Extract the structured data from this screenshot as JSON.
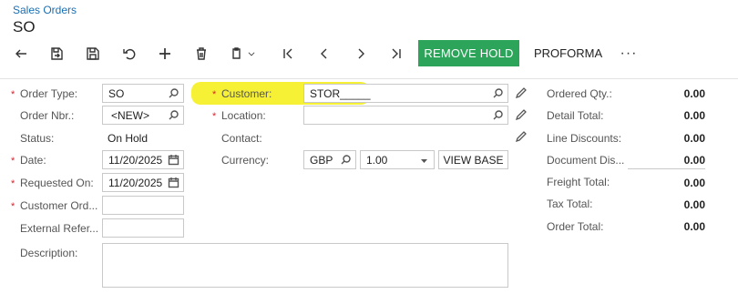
{
  "breadcrumb": "Sales Orders",
  "page_title": "SO",
  "toolbar": {
    "remove_hold_label": "REMOVE HOLD",
    "proforma_label": "PROFORMA",
    "more_label": "···"
  },
  "left": {
    "order_type_label": "Order Type:",
    "order_type_value": "SO",
    "order_nbr_label": "Order Nbr.:",
    "order_nbr_value": "<NEW>",
    "status_label": "Status:",
    "status_value": "On Hold",
    "date_label": "Date:",
    "date_value": "11/20/2025",
    "requested_on_label": "Requested On:",
    "requested_on_value": "11/20/2025",
    "customer_ord_label": "Customer Ord...",
    "customer_ord_value": "",
    "external_ref_label": "External Refer...",
    "external_ref_value": "",
    "description_label": "Description:",
    "description_value": ""
  },
  "middle": {
    "customer_label": "Customer:",
    "customer_value": "STOR_____",
    "location_label": "Location:",
    "location_value": "",
    "contact_label": "Contact:",
    "currency_label": "Currency:",
    "currency_value": "GBP",
    "rate_value": "1.00",
    "view_base_label": "VIEW BASE"
  },
  "summary": {
    "ordered_qty_label": "Ordered Qty.:",
    "ordered_qty_value": "0.00",
    "detail_total_label": "Detail Total:",
    "detail_total_value": "0.00",
    "line_discounts_label": "Line Discounts:",
    "line_discounts_value": "0.00",
    "document_dis_label": "Document Dis...",
    "document_dis_value": "0.00",
    "freight_total_label": "Freight Total:",
    "freight_total_value": "0.00",
    "tax_total_label": "Tax Total:",
    "tax_total_value": "0.00",
    "order_total_label": "Order Total:",
    "order_total_value": "0.00"
  },
  "colors": {
    "accent_green": "#2ca45a",
    "link_blue": "#1a6fb3",
    "required_red": "#d9232d",
    "highlight_yellow": "#f5f02a"
  },
  "icons": [
    "back-icon",
    "save-close-icon",
    "save-icon",
    "undo-icon",
    "add-icon",
    "delete-icon",
    "copy-paste-icon",
    "first-icon",
    "prev-icon",
    "next-icon",
    "last-icon",
    "search-icon",
    "calendar-icon",
    "pencil-icon",
    "dropdown-arrow-icon"
  ]
}
